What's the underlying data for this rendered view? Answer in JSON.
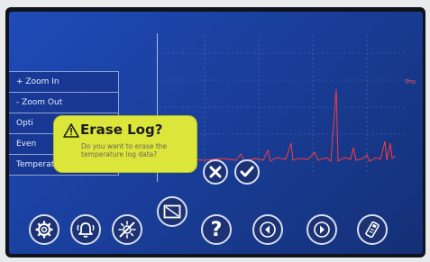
{
  "menu": {
    "items": [
      {
        "label": "+ Zoom In"
      },
      {
        "label": "- Zoom Out"
      },
      {
        "label": "Opti"
      },
      {
        "label": "Even"
      },
      {
        "label": "Temperature Log"
      }
    ]
  },
  "dialog": {
    "title": "Erase Log?",
    "message": "Do you want to erase the temperature log data?",
    "icon": "warning-icon",
    "cancel_icon": "close-icon",
    "confirm_icon": "check-icon"
  },
  "graph": {
    "series_color": "#ff3b3b",
    "series_tag": "Pro"
  },
  "toolbar": {
    "buttons": [
      "settings-icon",
      "alarm-bell-icon",
      "alarm-off-icon",
      "display-icon",
      "help-icon",
      "previous-icon",
      "next-icon",
      "usb-export-icon"
    ],
    "help_glyph": "?"
  },
  "colors": {
    "screen": "#1f4bb8",
    "dialog": "#dbe53a",
    "button_fill": "#1c3274"
  }
}
